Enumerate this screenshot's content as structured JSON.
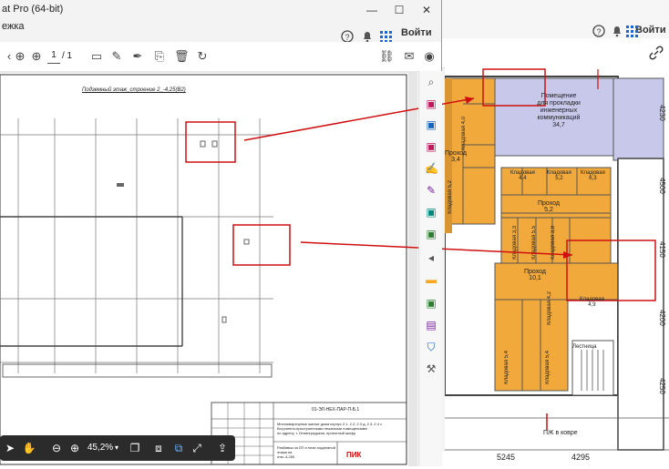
{
  "front_window": {
    "title": "at Pro (64-bit)",
    "menu_item": "ежка",
    "signin": "Войти",
    "page_current": "1",
    "page_total": "/ 1",
    "zoom": "45,2%"
  },
  "back_window": {
    "signin": "Войти"
  },
  "drawing": {
    "title": "Подземный этаж_строение 2_-4,25(В2)",
    "stamp_code": "01-ЭЛ-НЕХ-ПАР-П-Б.1",
    "stamp_desc1": "Многоквартирные жилые дома корпус 2.1, 2.2, 2.3 д, 2.3, 2.4 с",
    "stamp_desc2": "Встроенно-пристроенными нежилыми помещениями",
    "stamp_desc3": "по адресу: г. Ленинградская, проектный шифр",
    "stamp_sheet": "Разбивка на ЛП и план подземной этажа на",
    "stamp_sheet2": "отм.-4,250",
    "stamp_brand": "ПИК"
  },
  "plan": {
    "rooms": [
      {
        "name": "Помещение",
        "name2": "для прокладки",
        "name3": "инженерных",
        "name4": "коммуникаций",
        "area": "34,7"
      },
      {
        "name": "Проход",
        "area": "5,2"
      },
      {
        "name": "Проход",
        "area": "3,4"
      },
      {
        "name": "Проход",
        "area": "10,1"
      },
      {
        "name": "Кладовая",
        "area": "4,4"
      },
      {
        "name": "Кладовая",
        "area": "5,2"
      },
      {
        "name": "Кладовая",
        "area": "6,3"
      },
      {
        "name": "Кладовая",
        "area": "4,9"
      },
      {
        "name": "Кладовая",
        "area": "4,0"
      },
      {
        "name": "Кладовая",
        "area": "5,2"
      },
      {
        "name": "Кладовая",
        "area": "3,3"
      },
      {
        "name": "Кладовая",
        "area": "5,5"
      },
      {
        "name": "Кладовая",
        "area": "3,8"
      },
      {
        "name": "Кладовая",
        "area": "4,2"
      },
      {
        "name": "Кладовая",
        "area": "5,4"
      },
      {
        "name": "Кладовая",
        "area": "5,4"
      },
      {
        "name": "Лестница",
        "area": ""
      }
    ],
    "dims_bottom": [
      "5245",
      "4295"
    ],
    "dims_right": [
      "4230",
      "4500",
      "4150",
      "4200",
      "4250"
    ],
    "note": "ПЖ в коврe"
  },
  "colors": {
    "room_orange": "#f2a93b",
    "room_lavender": "#c8c8ea",
    "annotation_red": "#d01010"
  }
}
